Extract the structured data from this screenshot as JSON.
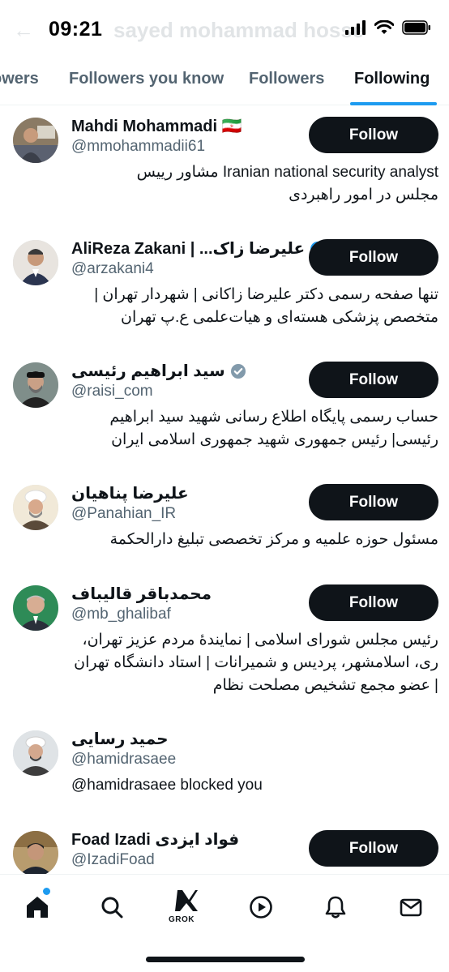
{
  "status_bar": {
    "time": "09:21",
    "faded_title": "sayed mohammad hosse"
  },
  "tabs": [
    {
      "label": "owers",
      "active": false
    },
    {
      "label": "Followers you know",
      "active": false
    },
    {
      "label": "Followers",
      "active": false
    },
    {
      "label": "Following",
      "active": true
    }
  ],
  "accent_color": "#1d9bf0",
  "users": [
    {
      "name": "Mahdi Mohammadi 🇮🇷",
      "handle": "@mmohammadii61",
      "verified": false,
      "button": "Follow",
      "bio": [
        "Iranian national security analyst مشاور رییس",
        "مجلس در امور راهبردی"
      ]
    },
    {
      "name": "AliReza Zakani | ...علیرضا زاک",
      "handle": "@arzakani4",
      "verified": true,
      "button": "Follow",
      "bio": [
        "تنها صفحه رسمی دکتر علیرضا زاکانی | شهردار تهران |",
        "متخصص پزشکی هسته‌ای و هیات‌علمی ع.پ تهران"
      ]
    },
    {
      "name": "سید ابراهیم رئیسی",
      "handle": "@raisi_com",
      "verified": true,
      "button": "Follow",
      "bio": [
        "حساب رسمی پایگاه اطلاع رسانی شهید سید ابراهیم",
        "رئیسی| رئیس جمهوری شهید جمهوری اسلامی ایران"
      ]
    },
    {
      "name": "علیرضا پناهیان",
      "handle": "@Panahian_IR",
      "verified": false,
      "button": "Follow",
      "bio": [
        "مسئول حوزه علمیه و مرکز تخصصی تبلیغ دارالحکمة"
      ]
    },
    {
      "name": "محمدباقر قالیباف",
      "handle": "@mb_ghalibaf",
      "verified": false,
      "button": "Follow",
      "bio": [
        "رئیس مجلس شورای اسلامی | نمایندهٔ مردم عزیز تهران،",
        "ری، اسلامشهر، پردیس و شمیرانات | استاد دانشگاه تهران",
        "| عضو مجمع تشخیص مصلحت نظام"
      ]
    },
    {
      "name": "حمید رسایی",
      "handle": "@hamidrasaee",
      "verified": false,
      "button": "",
      "bio": [
        "@hamidrasaee blocked you"
      ]
    },
    {
      "name": "Foad Izadi فواد ایزدی",
      "handle": "@IzadiFoad",
      "verified": false,
      "button": "Follow",
      "bio": []
    }
  ],
  "bottom_nav": {
    "items": [
      "home-icon",
      "search-icon",
      "grok-icon",
      "video-icon",
      "notifications-icon",
      "messages-icon"
    ],
    "grok_label": "GROK"
  }
}
